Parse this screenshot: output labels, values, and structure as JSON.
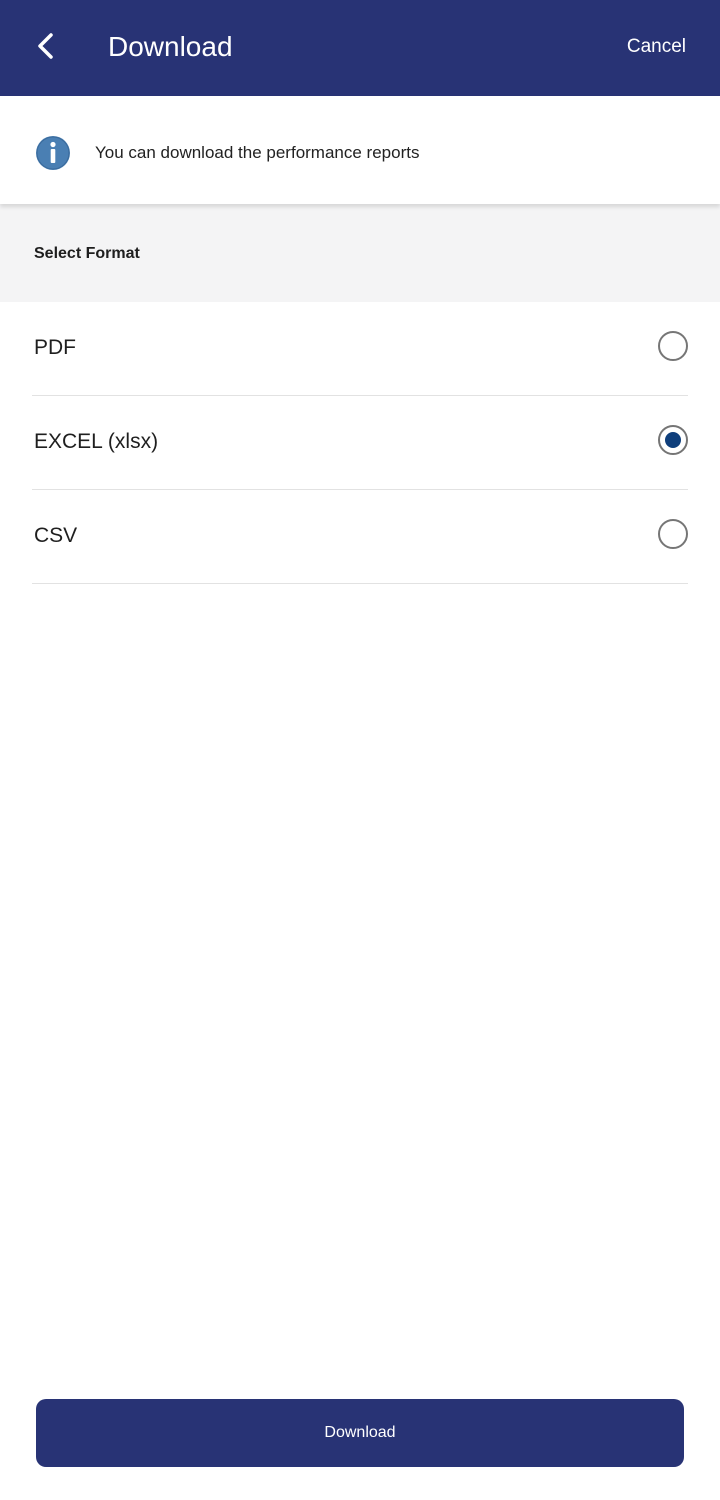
{
  "header": {
    "title": "Download",
    "cancel_label": "Cancel",
    "back_icon": "chevron-left-icon",
    "background_color": "#283375"
  },
  "info": {
    "icon": "info-icon",
    "text": "You can download the performance reports",
    "icon_color": "#4a7fb3"
  },
  "section": {
    "title": "Select Format"
  },
  "formats": [
    {
      "label": "PDF",
      "selected": false
    },
    {
      "label": "EXCEL (xlsx)",
      "selected": true
    },
    {
      "label": "CSV",
      "selected": false
    }
  ],
  "footer": {
    "download_label": "Download"
  },
  "colors": {
    "primary": "#283375",
    "radio_selected": "#0f3f7c"
  }
}
